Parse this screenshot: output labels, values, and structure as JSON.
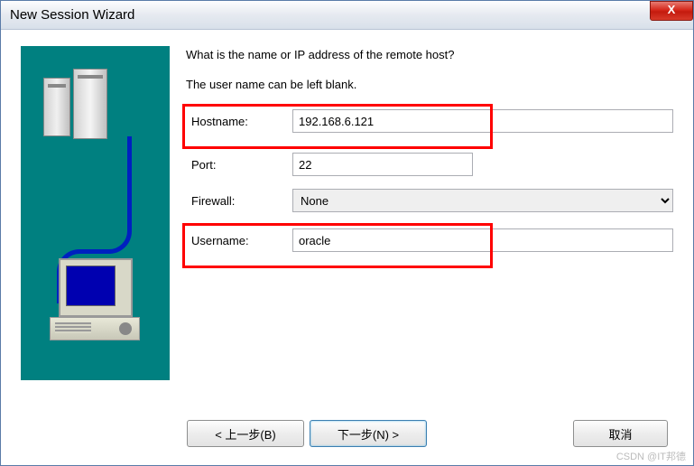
{
  "title": "New Session Wizard",
  "prompt": "What is the name or IP address of the remote host?",
  "hint": "The user name can be left blank.",
  "labels": {
    "hostname": "Hostname:",
    "port": "Port:",
    "firewall": "Firewall:",
    "username": "Username:"
  },
  "values": {
    "hostname": "192.168.6.121",
    "port": "22",
    "firewall": "None",
    "username": "oracle"
  },
  "buttons": {
    "back": "< 上一步(B)",
    "next": "下一步(N) >",
    "cancel": "取消"
  },
  "watermark": "CSDN @IT邦德"
}
